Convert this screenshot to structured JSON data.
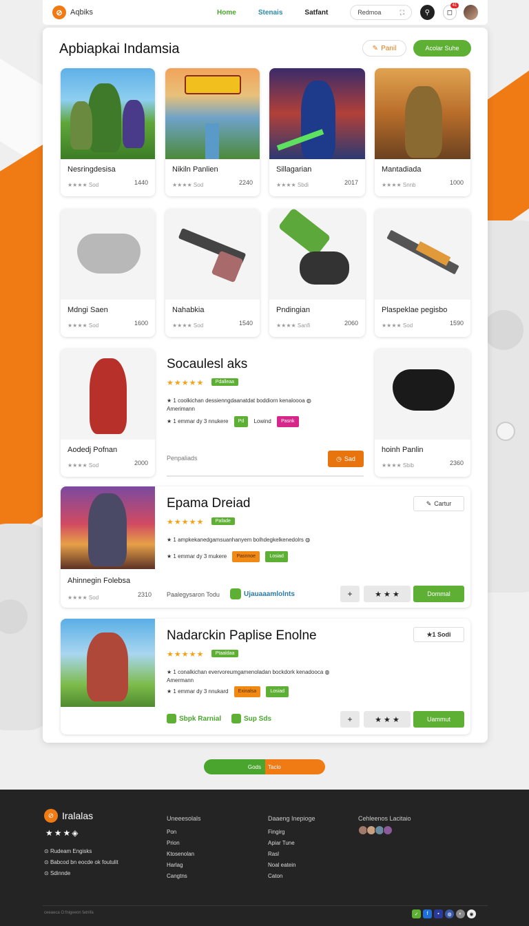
{
  "app": {
    "logo_text": "Aqbiks",
    "logo_glyph": "⊘"
  },
  "nav": {
    "links": [
      "Home",
      "Stenais",
      "Satfant"
    ],
    "search_value": "Redmoa",
    "bell_badge": "41"
  },
  "page": {
    "title": "Apbiapkai Indamsia",
    "panil_button": "Panil",
    "acolar_button": "Acolar Suhe"
  },
  "grid_row1": [
    {
      "name": "Nesringdesisa",
      "rating": "★★★★ Sod",
      "num": "1440"
    },
    {
      "name": "Nikiln Panlien",
      "rating": "★★★★ Sod",
      "num": "2240"
    },
    {
      "name": "Sillagarian",
      "rating": "★★★★ Sbdi",
      "num": "2017"
    },
    {
      "name": "Mantadiada",
      "rating": "★★★★ Snnb",
      "num": "1000"
    }
  ],
  "grid_row2": [
    {
      "name": "Mdngi Saen",
      "rating": "★★★★ Sod",
      "num": "1600"
    },
    {
      "name": "Nahabkia",
      "rating": "★★★★ Sod",
      "num": "1540"
    },
    {
      "name": "Pndingian",
      "rating": "★★★★ Sanfi",
      "num": "2060"
    },
    {
      "name": "Plaspeklae pegisbo",
      "rating": "★★★★ Sod",
      "num": "1590"
    }
  ],
  "row3": {
    "left_card": {
      "name": "Aodedj Pofnan",
      "rating": "★★★★ Sod",
      "num": "2000"
    },
    "right_card": {
      "name": "hoinh Panlin",
      "rating": "★★★★ Sbib",
      "num": "2360"
    },
    "feature": {
      "title": "Socaulesl aks",
      "stars": "★★★★★",
      "tag": "Pdalleaa",
      "line1": "★ 1  coolkichan dessienngdaanatdat boddiorn kenaloooa  ◍",
      "line1b": "Amerimann",
      "line2": "★ 1  emmar dy 3 nnukere",
      "tag2": "Pd",
      "tag2_text": "Lowind",
      "tag3": "Pasnk",
      "footer_text": "Penpaliads",
      "button": "Sad"
    }
  },
  "row4": {
    "left_card": {
      "name": "Ahinnegin Folebsa",
      "rating": "★★★★ Sod",
      "num": "2310"
    },
    "feature": {
      "title": "Epama Dreiad",
      "stars": "★★★★★",
      "tag": "Pafade",
      "line1": "★ 1  ampkekanedgamsuanhanyem bolhdegkelkenedolrs  ◍",
      "line2": "★ 1  emmar dy 3 mukere",
      "tag2": "Pasnnoe",
      "tag3": "Losiad",
      "cartur_button": "Cartur",
      "footer_label": "Paalegysaron Todu",
      "footer_link": "Ujauaaamlolnts",
      "plus": "+",
      "stars_btn": "★ ★ ★",
      "button": "Dommal"
    }
  },
  "row5": {
    "feature": {
      "title": "Nadarckin Paplise Enolne",
      "stars": "★★★★★",
      "tag": "Ptaaldaa",
      "line1": "★ 1  conalkichan evervoreumgamenoladan bockdork kenadooca  ◍",
      "line1b": "Amermann",
      "line2": "★ 1  emmar dy 3 nnukard",
      "tag2": "Exinalsa",
      "tag3": "Losiad",
      "corner_button": "★1 Sodi",
      "chip1": "Sbpk Rarnial",
      "chip2": "Sup Sds",
      "plus": "+",
      "stars_btn": "★ ★ ★",
      "button": "Uammut"
    }
  },
  "pill": {
    "left": "Gods",
    "right": "Taclo"
  },
  "footer": {
    "brand": "Iralalas",
    "stars": "★★★◈",
    "col1": [
      "Rudeam Engisks",
      "Babcod bn eocde ok foutulit",
      "Sdinnde"
    ],
    "col2_head": "Uneeesolals",
    "col2": [
      "Pon",
      "Prion",
      "Ktosenolan",
      "Harlag",
      "Cangtns"
    ],
    "col3_head": "Daaeng Inepioge",
    "col3": [
      "Fingirg",
      "Apiar Tune",
      "Rasl",
      "Noal eatein",
      "Caton"
    ],
    "col4_head": "Cehleenos Lacitaio",
    "copyright": "ceeaeca O:fnigeeon fatnifa",
    "colors": {
      "green": "#5db034",
      "blue": "#1e6fd8",
      "navy": "#2a3a9a",
      "gray": "#888",
      "white": "#eee"
    }
  },
  "colors": {
    "accent_orange": "#f07a14",
    "accent_green": "#5db034"
  }
}
